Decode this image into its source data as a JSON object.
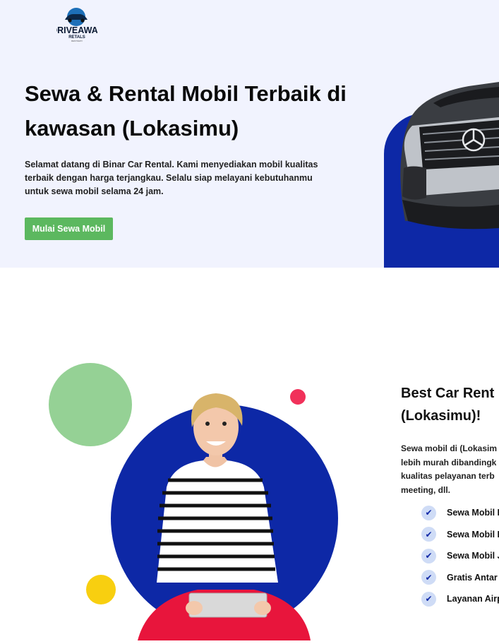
{
  "header": {
    "logo": {
      "text": "DRIVEAWAY",
      "subtext": "RETALS",
      "tagline": "RENTAWAY"
    }
  },
  "hero": {
    "title_line1": "Sewa & Rental Mobil Terbaik di",
    "title_line2": "kawasan (Lokasimu)",
    "desc_line1": "Selamat datang di Binar Car Rental. Kami menyediakan mobil kualitas",
    "desc_line2": "terbaik dengan harga terjangkau. Selalu siap melayani kebutuhanmu",
    "desc_line3": "untuk sewa mobil selama 24 jam.",
    "cta_label": "Mulai Sewa Mobil"
  },
  "services": {
    "title_line1": "Best Car Rent",
    "title_line2": "(Lokasimu)!",
    "desc_lines": [
      "Sewa mobil di (Lokasim",
      "lebih murah dibandingk",
      "kualitas pelayanan terb",
      "meeting, dll."
    ],
    "features": [
      {
        "label": "Sewa Mobil D"
      },
      {
        "label": "Sewa Mobil L"
      },
      {
        "label": "Sewa Mobil J"
      },
      {
        "label": "Gratis Antar"
      },
      {
        "label": "Layanan Airp"
      }
    ]
  },
  "colors": {
    "hero_bg": "#f1f3fe",
    "brand_blue": "#0d28a6",
    "cta_green": "#5cb85f",
    "check_bg": "#cfdcf6"
  }
}
